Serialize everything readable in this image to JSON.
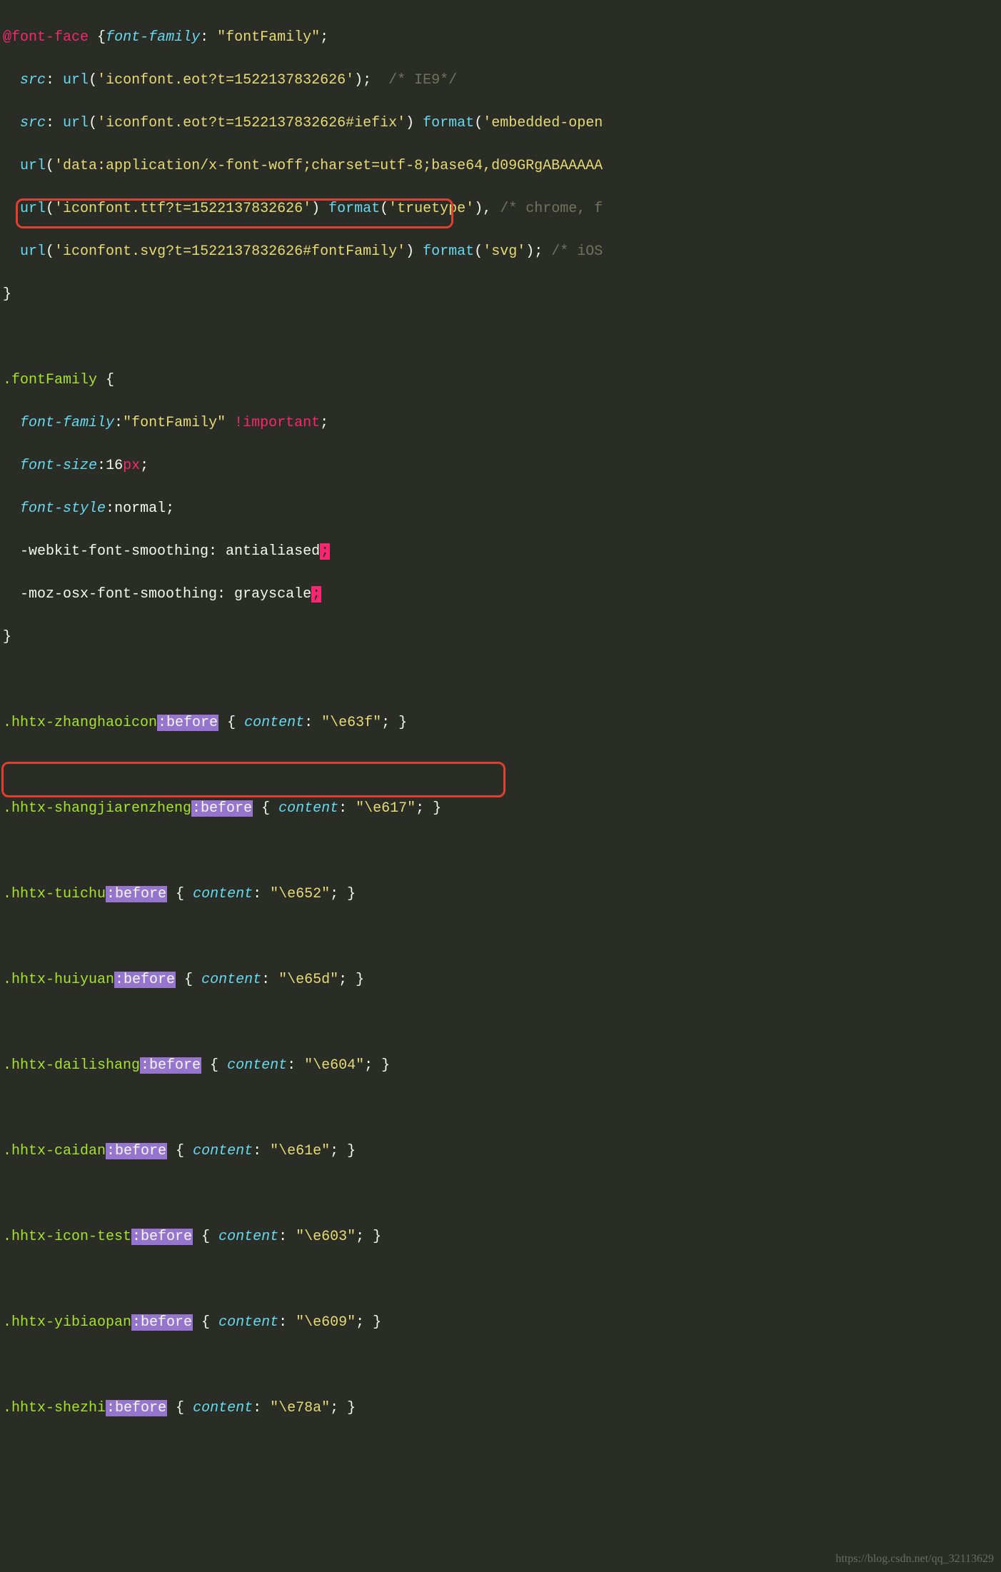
{
  "fontface": {
    "at": "@font-face",
    "space": " ",
    "brace_open": "{",
    "ff_prop": "font-family",
    "colon": ":",
    "ff_val": " \"fontFamily\"",
    "semi": ";",
    "line2_indent": "  ",
    "src_prop": "src",
    "url_fn": "url",
    "l2_paren_open": "(",
    "l2_str": "'iconfont.eot?t=1522137832626'",
    "l2_paren_close": ")",
    "l2_comment": " /* IE9*/",
    "l3_str": "'iconfont.eot?t=1522137832626#iefix'",
    "format_fn": "format",
    "l3_fmt": "'embedded-open",
    "l4_str": "'data:application/x-font-woff;charset=utf-8;base64,d09GRgABAAAAA",
    "l5_str": "'iconfont.ttf?t=1522137832626'",
    "l5_fmt": "'truetype'",
    "l5_comment": " /* chrome, f",
    "l6_str": "'iconfont.svg?t=1522137832626#fontFamily'",
    "l6_fmt": "'svg'",
    "l6_comment": " /* iOS",
    "brace_close": "}"
  },
  "fontFamily": {
    "selector": ".fontFamily",
    "brace_open": " {",
    "l1_prop": "font-family",
    "l1_val": "\"fontFamily\"",
    "important": "!important",
    "l2_prop": "font-size",
    "l2_val": "16",
    "l2_unit": "px",
    "l3_prop": "font-style",
    "l3_val": "normal",
    "l4": "  -webkit-font-smoothing: antialiased",
    "l5": "  -moz-osx-font-smoothing: grayscale",
    "semi_hl": ";",
    "brace_close": "}"
  },
  "before": ":before",
  "content_prop": "content",
  "rules": [
    {
      "sel": ".hhtx-zhanghaoicon",
      "val": "\"\\e63f\""
    },
    {
      "sel": ".hhtx-shangjiarenzheng",
      "val": "\"\\e617\""
    },
    {
      "sel": ".hhtx-tuichu",
      "val": "\"\\e652\""
    },
    {
      "sel": ".hhtx-huiyuan",
      "val": "\"\\e65d\""
    },
    {
      "sel": ".hhtx-dailishang",
      "val": "\"\\e604\""
    },
    {
      "sel": ".hhtx-caidan",
      "val": "\"\\e61e\""
    },
    {
      "sel": ".hhtx-icon-test",
      "val": "\"\\e603\""
    },
    {
      "sel": ".hhtx-yibiaopan",
      "val": "\"\\e609\""
    },
    {
      "sel": ".hhtx-shezhi",
      "val": "\"\\e78a\""
    }
  ],
  "watermark": "https://blog.csdn.net/qq_32113629"
}
